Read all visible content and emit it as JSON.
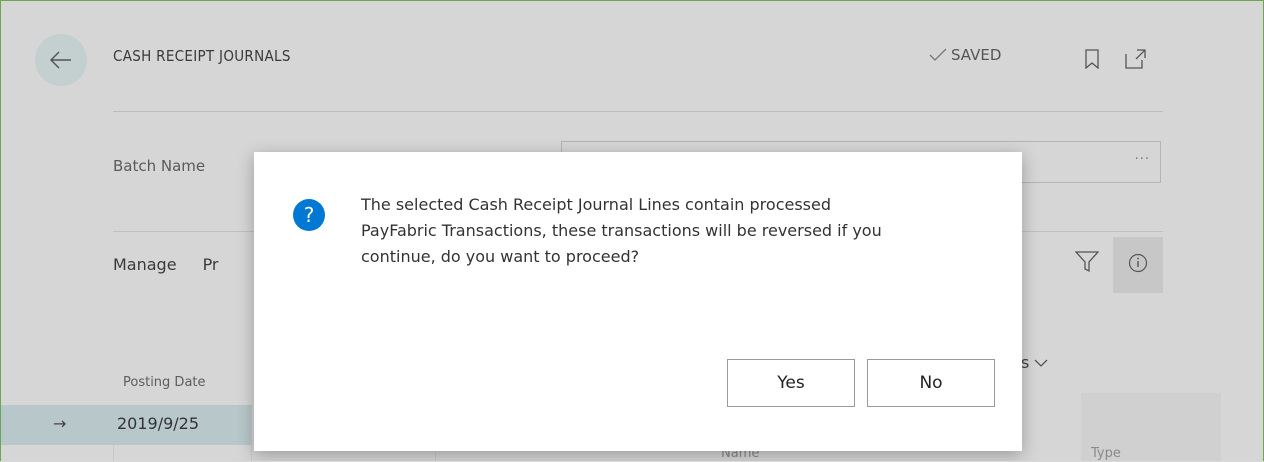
{
  "header": {
    "title": "CASH RECEIPT JOURNALS",
    "saved_label": "SAVED"
  },
  "form": {
    "batch_name_label": "Batch Name",
    "batch_more": "···"
  },
  "action_bar": {
    "manage": "Manage",
    "partial": "Pr"
  },
  "grid": {
    "posting_date_header": "Posting Date",
    "partial_header": "s",
    "name_header": "Name",
    "type_header": "Type",
    "rows": [
      {
        "posting_date": "2019/9/25"
      }
    ]
  },
  "dialog": {
    "message_line1": "The selected Cash Receipt Journal Lines contain processed",
    "message_line2": "PayFabric Transactions, these transactions will be reversed if you",
    "message_line3": "continue, do you want to proceed?",
    "yes_label": "Yes",
    "no_label": "No",
    "question_mark": "?"
  },
  "icons": {
    "back": "back-arrow-icon",
    "saved": "checkmark-icon",
    "bookmark": "bookmark-icon",
    "popout": "popout-icon",
    "filter": "filter-icon",
    "info": "info-icon",
    "question": "question-icon"
  },
  "colors": {
    "accent": "#0078d4",
    "row_highlight": "#b7c7ca"
  }
}
